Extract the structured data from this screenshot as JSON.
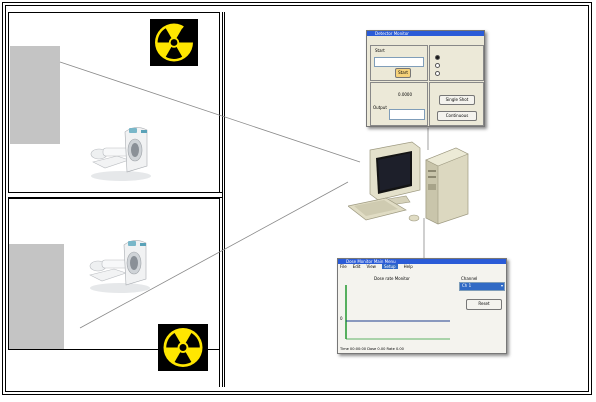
{
  "icons": {
    "radiation": "radiation-trefoil",
    "scanner": "ct-scanner",
    "computer": "desktop-computer"
  },
  "colors": {
    "hazard_background": "#000000",
    "hazard_symbol": "#ffe600",
    "detector": "#c4c4c4",
    "plot_axis": "#2e9e3a",
    "plot_trace": "#1f3f8f",
    "title_bar": "#2a5bd7",
    "window_face": "#ece9d8"
  },
  "control_window": {
    "title": "Detector Monitor",
    "start_label": "Start",
    "start_button": "Start",
    "detector_label": "0.0000",
    "output_label": "Output",
    "result_button": "Single Shot",
    "exit_button": "Continuous"
  },
  "plot_window": {
    "title": "Dose Monitor Main Menu",
    "menu": [
      "File",
      "Edit",
      "View",
      "Setup",
      "Help"
    ],
    "active_menu_index": 3,
    "plot_title": "Dose rate Monitor",
    "y_axis_label": "0",
    "select_label": "Channel",
    "select_value": "Ch 1",
    "button": "Reset",
    "status_bar": "Time 00:00:00  Dose 0.00  Rate 0.00"
  }
}
